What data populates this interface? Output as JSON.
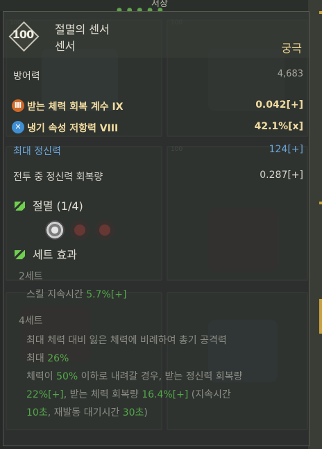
{
  "background": {
    "title": "저장",
    "slot_level": "100"
  },
  "item": {
    "level": "100",
    "name": "절멸의 센서",
    "type": "센서",
    "grade": "궁극"
  },
  "base_stat": {
    "label": "방어력",
    "value": "4,683"
  },
  "options": [
    {
      "icon": "orange-rune-icon",
      "label": "받는 체력 회복 계수 IX",
      "value": "0.042[+]"
    },
    {
      "icon": "blue-cross-icon",
      "label": "냉기 속성 저항력 VIII",
      "value": "42.1%[x]"
    }
  ],
  "extra_stats": [
    {
      "label": "최대 정신력",
      "value": "124[+]"
    },
    {
      "label": "전투 중 정신력 회복량",
      "value": "0.287[+]"
    }
  ],
  "set": {
    "name": "절멸 (1/4)",
    "effects_title": "세트 효과",
    "tier2_label": "2세트",
    "tier2_text_a": "스킬 지속시간 ",
    "tier2_val": "5.7%[+]",
    "tier4_label": "4세트",
    "tier4_line1": "최대 체력 대비 잃은 체력에 비례하여 총기 공격력",
    "tier4_line2_a": "최대 ",
    "tier4_line2_val": "26%",
    "tier4_line3_a": "체력이 ",
    "tier4_line3_val1": "50%",
    "tier4_line3_b": " 이하로 내려갈 경우, 받는 정신력 회복량",
    "tier4_line4_val1": "22%[+]",
    "tier4_line4_b": ", 받는 체력 회복량 ",
    "tier4_line4_val2": "16.4%[+]",
    "tier4_line4_c": " (지속시간",
    "tier4_line5_val1": "10초",
    "tier4_line5_b": ", 재발동 대기시간 ",
    "tier4_line5_val2": "30초",
    "tier4_line5_c": ")"
  },
  "colors": {
    "grade": "#e3c98a",
    "option": "#f2dca0",
    "blue_stat": "#6aa3d8",
    "set_value": "#53a949"
  }
}
